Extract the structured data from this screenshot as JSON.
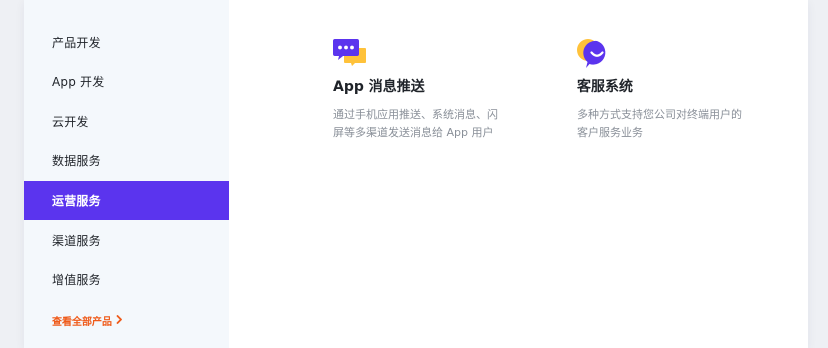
{
  "sidebar": {
    "items": [
      {
        "label": "产品开发",
        "active": false
      },
      {
        "label": "App 开发",
        "active": false
      },
      {
        "label": "云开发",
        "active": false
      },
      {
        "label": "数据服务",
        "active": false
      },
      {
        "label": "运营服务",
        "active": true
      },
      {
        "label": "渠道服务",
        "active": false
      },
      {
        "label": "增值服务",
        "active": false
      }
    ],
    "view_all_label": "查看全部产品",
    "view_all_icon": "chevron-right-icon",
    "active_color": "#5b34ee",
    "link_color": "#ef5a19"
  },
  "main": {
    "cards": [
      {
        "icon": "chat-bubbles-icon",
        "title": "App 消息推送",
        "description": "通过手机应用推送、系统消息、闪屏等多渠道发送消息给 App 用户"
      },
      {
        "icon": "smile-bubble-icon",
        "title": "客服系统",
        "description": "多种方式支持您公司对终端用户的客户服务业务"
      }
    ]
  }
}
